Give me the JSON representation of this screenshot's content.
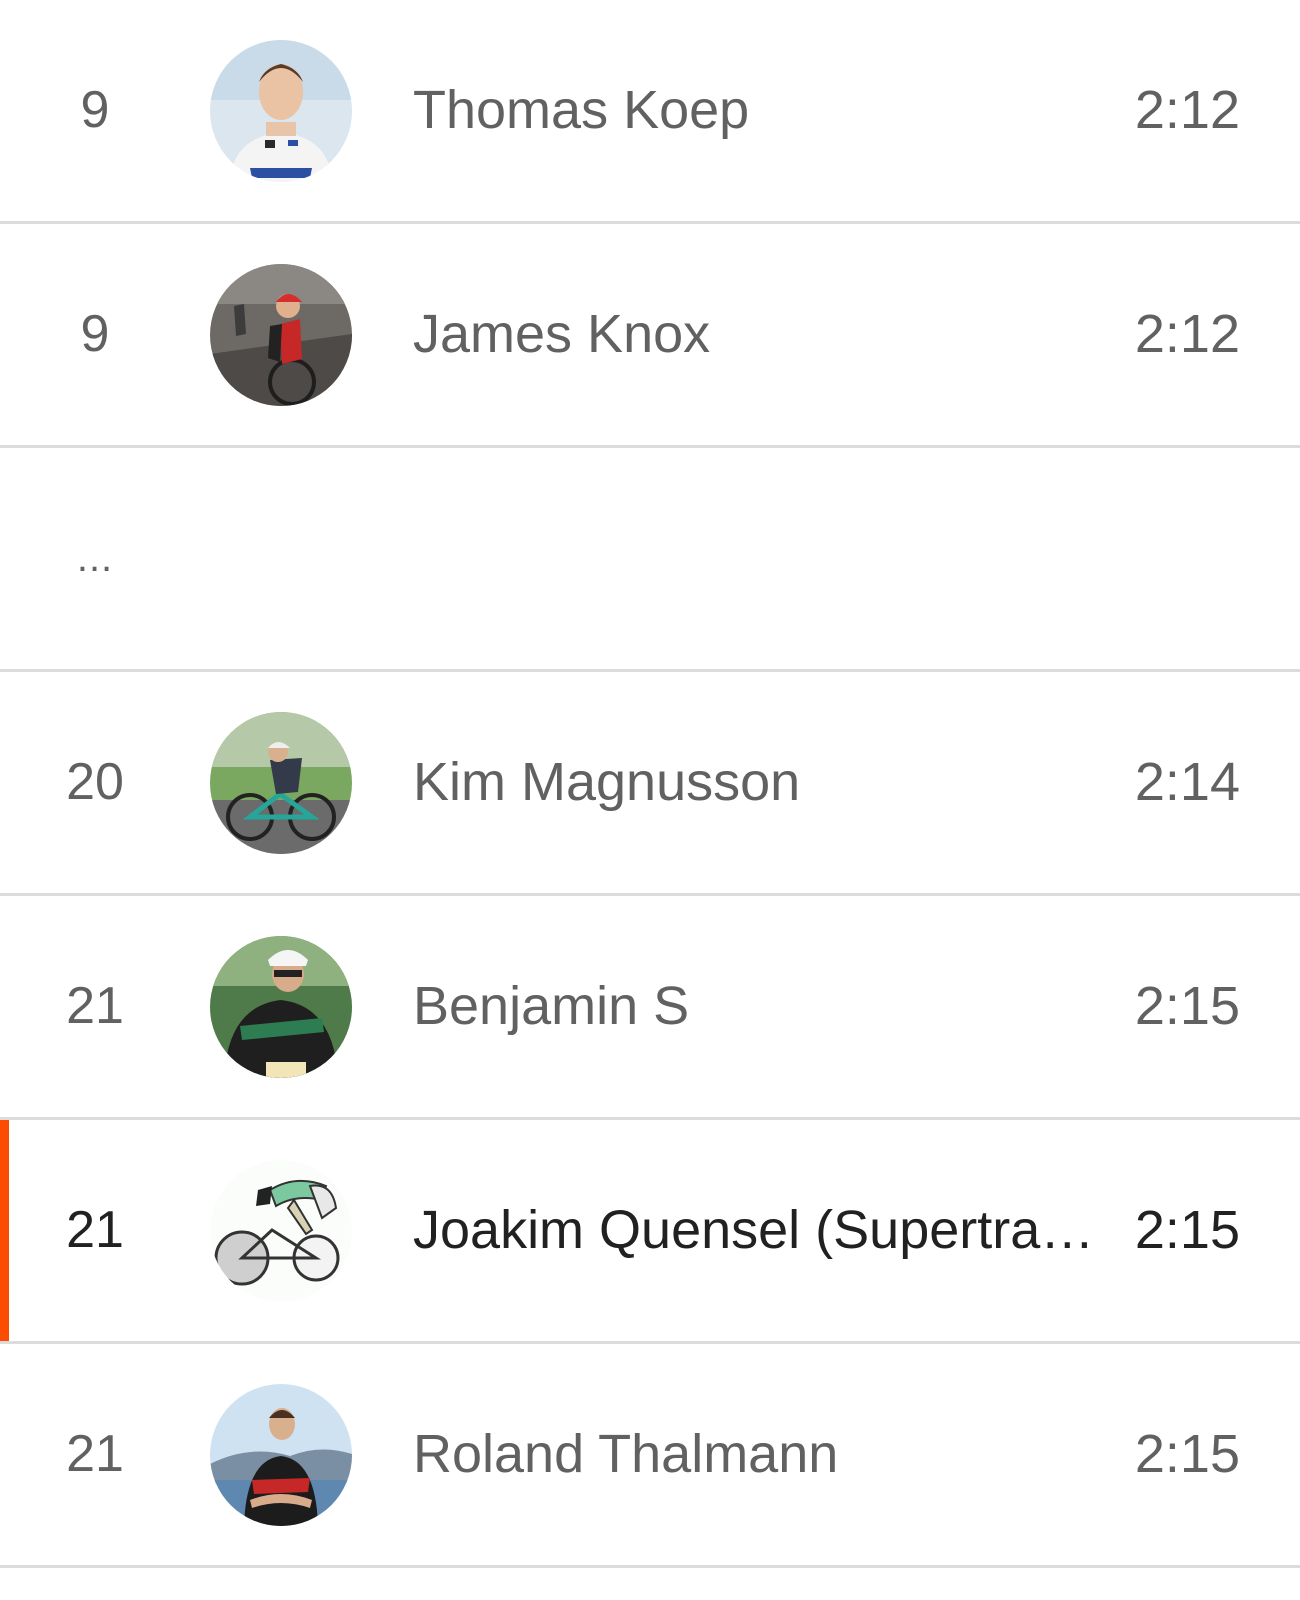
{
  "accent_color": "#fc4c02",
  "leaderboard": {
    "rows": [
      {
        "rank": "9",
        "name": "Thomas Koep",
        "time": "2:12",
        "avatar_icon": "athlete-photo-icon"
      },
      {
        "rank": "9",
        "name": "James Knox",
        "time": "2:12",
        "avatar_icon": "athlete-photo-icon"
      },
      {
        "rank": "...",
        "name": "",
        "time": ""
      },
      {
        "rank": "20",
        "name": "Kim Magnusson",
        "time": "2:14",
        "avatar_icon": "athlete-photo-icon"
      },
      {
        "rank": "21",
        "name": "Benjamin S",
        "time": "2:15",
        "avatar_icon": "athlete-photo-icon"
      },
      {
        "rank": "21",
        "name": "Joakim Quensel (Supertram…",
        "time": "2:15",
        "avatar_icon": "cyclist-cartoon-icon",
        "current_user": true
      },
      {
        "rank": "21",
        "name": "Roland Thalmann",
        "time": "2:15",
        "avatar_icon": "athlete-photo-icon"
      }
    ]
  }
}
